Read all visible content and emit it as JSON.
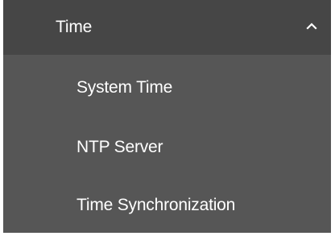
{
  "menu": {
    "section": {
      "label": "Time",
      "expanded": true,
      "toggle_icon": "chevron-up-icon"
    },
    "items": [
      {
        "label": "System Time"
      },
      {
        "label": "NTP Server"
      },
      {
        "label": "Time Synchronization"
      }
    ]
  },
  "colors": {
    "header_bg": "#464646",
    "menu_bg": "#565656",
    "text": "#ffffff"
  }
}
